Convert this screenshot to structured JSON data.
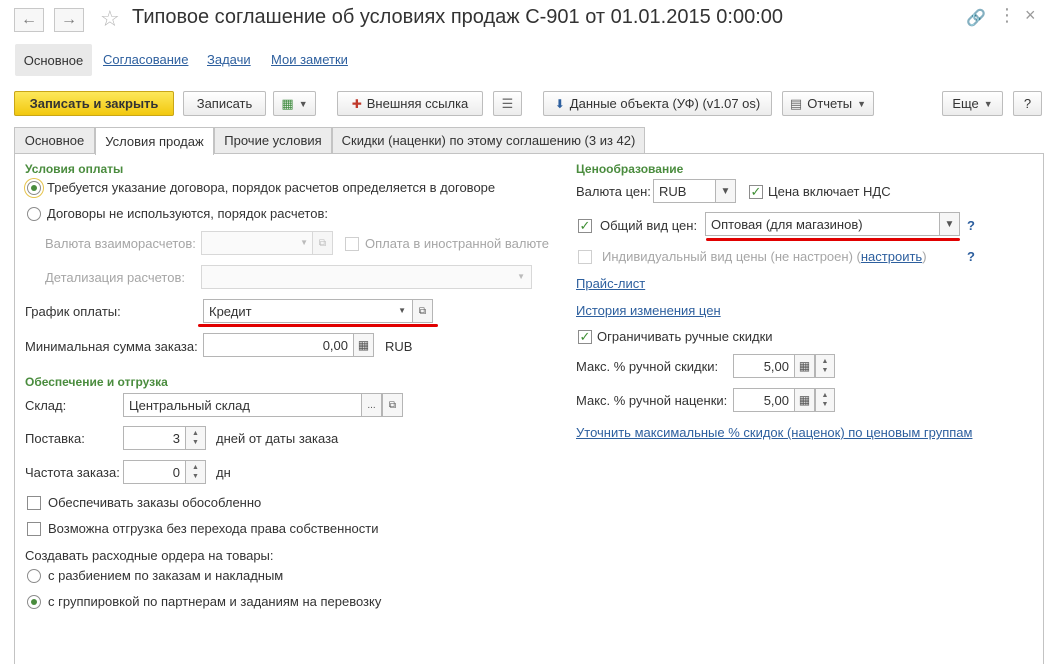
{
  "window": {
    "title": "Типовое соглашение об условиях продаж С-901 от 01.01.2015 0:00:00",
    "icons": [
      "back-arrow",
      "forward-arrow",
      "star",
      "link",
      "more-vertical",
      "close"
    ]
  },
  "sections": {
    "current": "Основное",
    "links": [
      "Согласование",
      "Задачи",
      "Мои заметки"
    ]
  },
  "toolbar": {
    "save_close": "Записать и закрыть",
    "save": "Записать",
    "external_link": "Внешняя ссылка",
    "object_data": "Данные объекта (УФ) (v1.07 os)",
    "reports": "Отчеты",
    "more": "Еще",
    "help": "?"
  },
  "tabs": [
    "Основное",
    "Условия продаж",
    "Прочие условия",
    "Скидки (наценки) по этому соглашению (3 из 42)"
  ],
  "active_tab": "Условия продаж",
  "payment": {
    "group": "Условия оплаты",
    "opt1": "Требуется указание договора, порядок расчетов определяется в договоре",
    "opt2": "Договоры не используются, порядок расчетов:",
    "selected": "opt1",
    "currency_label": "Валюта взаиморасчетов:",
    "foreign_currency": "Оплата в иностранной валюте",
    "detail_label": "Детализация расчетов:",
    "schedule_label": "График оплаты:",
    "schedule_value": "Кредит",
    "min_sum_label": "Минимальная сумма заказа:",
    "min_sum_value": "0,00",
    "min_sum_currency": "RUB"
  },
  "shipping": {
    "group": "Обеспечение и отгрузка",
    "warehouse_label": "Склад:",
    "warehouse_value": "Центральный склад",
    "delivery_label": "Поставка:",
    "delivery_value": "3",
    "delivery_suffix": "дней от даты заказа",
    "freq_label": "Частота заказа:",
    "freq_value": "0",
    "freq_suffix": "дн",
    "separate_orders": "Обеспечивать заказы обособленно",
    "ship_without_ownership": "Возможна отгрузка без перехода права собственности",
    "expense_orders_label": "Создавать расходные ордера на товары:",
    "expense_opt1": "с разбиением по заказам и накладным",
    "expense_opt2": "с группировкой по партнерам и заданиям на перевозку",
    "expense_selected": "opt2"
  },
  "pricing": {
    "group": "Ценообразование",
    "currency_label": "Валюта цен:",
    "currency_value": "RUB",
    "vat_included": "Цена включает НДС",
    "vat_checked": true,
    "common_price_label": "Общий вид цен:",
    "common_price_checked": true,
    "common_price_value": "Оптовая (для магазинов)",
    "individual_price": "Индивидуальный вид цены (не настроен)",
    "individual_price_setup": "настроить",
    "price_list_link": "Прайс-лист",
    "price_history_link": "История изменения цен",
    "limit_manual_discounts": "Ограничивать ручные скидки",
    "limit_checked": true,
    "max_discount_label": "Макс. % ручной скидки:",
    "max_discount_value": "5,00",
    "max_markup_label": "Макс. % ручной наценки:",
    "max_markup_value": "5,00",
    "refine_link": "Уточнить максимальные % скидок (наценок) по ценовым группам",
    "help": "?"
  }
}
